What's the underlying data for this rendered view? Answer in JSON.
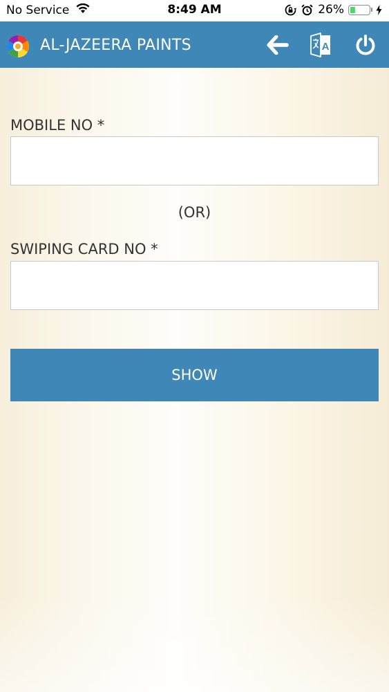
{
  "status_bar": {
    "carrier": "No Service",
    "time": "8:49 AM",
    "battery_percent": "26%",
    "battery_level": 0.26,
    "icons": [
      "wifi-icon",
      "orientation-lock-icon",
      "alarm-icon",
      "battery-icon",
      "charging-bolt-icon"
    ]
  },
  "header": {
    "title": "AL-JAZEERA PAINTS",
    "logo_icon": "paint-color-wheel-logo",
    "back_icon": "arrow-left-icon",
    "translate_icon": "translate-icon",
    "power_icon": "power-icon",
    "background_color": "#3f87b7"
  },
  "form": {
    "mobile_label": "MOBILE NO *",
    "mobile_value": "",
    "or_text": "(OR)",
    "card_label": "SWIPING CARD NO *",
    "card_value": "",
    "show_button_label": "SHOW"
  },
  "colors": {
    "accent": "#3f87b7",
    "background": "#fbf4e3",
    "label_text": "#333333"
  }
}
